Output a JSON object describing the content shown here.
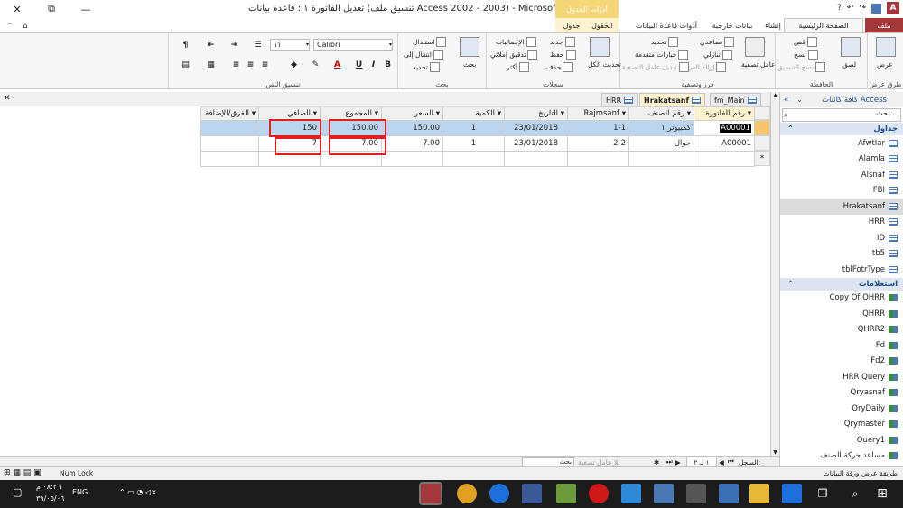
{
  "window": {
    "title": "تعديل الفاتورة ١ : قاعدة بيانات (تنسيق ملف Access 2002 - 2003) - Microsoft Access",
    "context_group": "أدوات الجدول",
    "close_glyph": "✕",
    "restore_glyph": "⧉",
    "minimize_glyph": "—",
    "help_glyph": "?",
    "app_badge": "A"
  },
  "ribbon_tabs": {
    "file": "ملف",
    "home": "الصفحة الرئيسية",
    "create": "إنشاء",
    "external": "بيانات خارجية",
    "dbtools": "أدوات قاعدة البيانات",
    "fields": "الحقول",
    "table": "جدول"
  },
  "ribbon": {
    "views": {
      "label": "طرق عرض",
      "view": "عرض"
    },
    "clipboard": {
      "label": "الحافظة",
      "paste": "لصق",
      "cut": "قص",
      "copy": "نسخ",
      "format_painter": "نسخ التنسيق"
    },
    "sort_filter": {
      "label": "فرز وتصفية",
      "filter": "عامل تصفية",
      "ascending": "تصاعدي",
      "descending": "تنازلي",
      "remove_sort": "إزالة الفرز",
      "selection": "تحديد",
      "advanced": "خيارات متقدمة",
      "toggle": "تبديل عامل التصفية"
    },
    "records": {
      "label": "سجلات",
      "refresh": "تحديث الكل",
      "new": "جديد",
      "save": "حفظ",
      "delete": "حذف",
      "totals": "الإجماليات",
      "spelling": "تدقيق إملائي",
      "more": "أكثر"
    },
    "find": {
      "label": "بحث",
      "find": "بحث",
      "replace": "استبدال",
      "goto": "انتقال إلى",
      "select": "تحديد"
    },
    "text_format": {
      "label": "تنسيق النص",
      "font": "Calibri",
      "size": "١١"
    }
  },
  "doc_tabs": [
    {
      "name": "fm_Main"
    },
    {
      "name": "Hrakatsanf"
    },
    {
      "name": "HRR"
    }
  ],
  "datasheet": {
    "columns": [
      "رقم الفاتورة",
      "رقم الصنف",
      "Rajmsanf",
      "التاريخ",
      "الكمية",
      "السعر",
      "المجموع",
      "الصافي",
      "الفرق/الإضافة"
    ],
    "rows": [
      [
        "A00001",
        "كمبيوتر ١",
        "1-1",
        "23/01/2018",
        "1",
        "150.00",
        "150.00",
        "150",
        ""
      ],
      [
        "A00001",
        "جوال",
        "2-2",
        "23/01/2018",
        "1",
        "7.00",
        "7.00",
        "7",
        ""
      ]
    ],
    "new_row_marker": "*"
  },
  "record_nav": {
    "label": "السجل:",
    "position": "١ لـ ٢",
    "filter": "بلا عامل تصفية",
    "search": "بحث"
  },
  "nav_pane": {
    "title": "كافة كائنات Access",
    "search_placeholder": "بحث...",
    "tables_header": "جداول",
    "tables": [
      "AfwtIar",
      "Alamla",
      "Alsnaf",
      "FBI",
      "Hrakatsanf",
      "HRR",
      "ID",
      "tb5",
      "tblFotrType"
    ],
    "queries_header": "استعلامات",
    "queries": [
      "Copy Of QHRR",
      "QHRR",
      "QHRR2",
      "Fd",
      "Fd2",
      "HRR Query",
      "Qryasnaf",
      "QryDaily",
      "Qrymaster",
      "Query1",
      "مساعد حركة الصنف"
    ]
  },
  "status": {
    "left": "طريقة عرض ورقة البيانات",
    "numlock": "Num Lock"
  },
  "taskbar": {
    "time": "٠٨:٢٦ م",
    "date": "٣٩/٠٥/٠٦",
    "lang": "ENG"
  },
  "colors": {
    "access_red": "#a4373a",
    "context_yellow": "#f5d77a",
    "selected_row": "#bcd5ee",
    "highlight_box": "#e02020"
  }
}
